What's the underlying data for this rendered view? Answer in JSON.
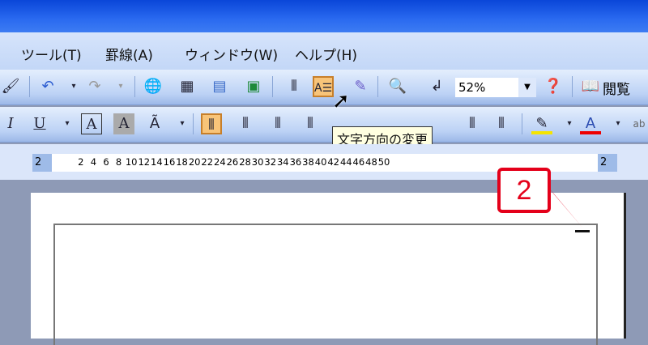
{
  "menu": {
    "tools": "ツール(T)",
    "borders": "罫線(A)",
    "window": "ウィンドウ(W)",
    "help": "ヘルプ(H)"
  },
  "toolbar": {
    "zoom_value": "52%",
    "reading_label": "閲覧"
  },
  "tooltip": "文字方向の変更",
  "ruler": {
    "left_end": "2",
    "right_end": "2",
    "ticks": [
      "2",
      "4",
      "6",
      "8",
      "10",
      "12",
      "14",
      "16",
      "18",
      "20",
      "22",
      "24",
      "26",
      "28",
      "30",
      "32",
      "34",
      "36",
      "38",
      "40",
      "42",
      "44",
      "46",
      "48",
      "50"
    ]
  },
  "callout": "2"
}
